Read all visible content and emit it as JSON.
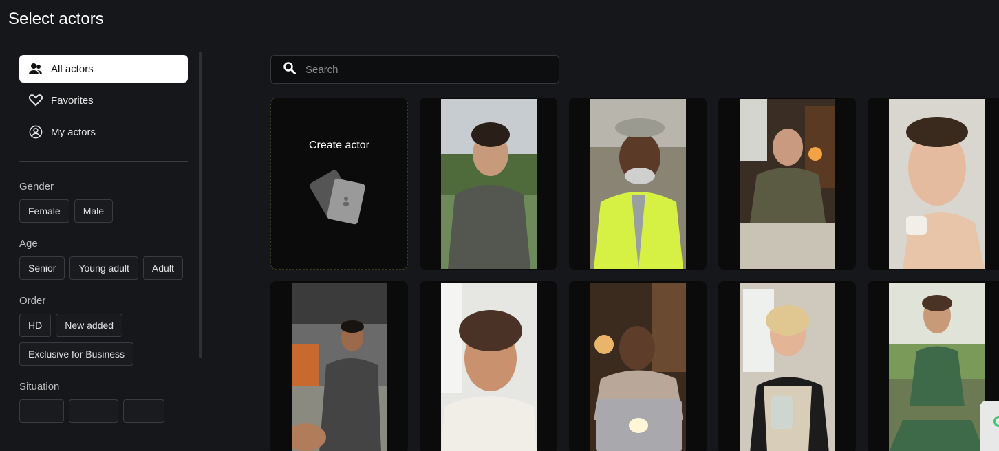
{
  "page": {
    "title": "Select actors"
  },
  "nav": {
    "items": [
      {
        "label": "All actors",
        "icon": "users-icon",
        "active": true
      },
      {
        "label": "Favorites",
        "icon": "heart-icon",
        "active": false
      },
      {
        "label": "My actors",
        "icon": "user-circle-icon",
        "active": false
      }
    ]
  },
  "filters": {
    "gender": {
      "label": "Gender",
      "options": [
        "Female",
        "Male"
      ]
    },
    "age": {
      "label": "Age",
      "options": [
        "Senior",
        "Young adult",
        "Adult"
      ]
    },
    "order": {
      "label": "Order",
      "options": [
        "HD",
        "New added",
        "Exclusive for Business"
      ]
    },
    "situation": {
      "label": "Situation"
    }
  },
  "search": {
    "placeholder": "Search",
    "value": ""
  },
  "create_card": {
    "label": "Create actor"
  },
  "actors": [
    {
      "name": "young-man-hiking"
    },
    {
      "name": "construction-worker"
    },
    {
      "name": "man-with-glasses-desk"
    },
    {
      "name": "woman-skincare"
    },
    {
      "name": "man-train-station"
    },
    {
      "name": "woman-bathrobe"
    },
    {
      "name": "man-laptop"
    },
    {
      "name": "older-woman-jar"
    },
    {
      "name": "woman-yoga"
    }
  ],
  "colors": {
    "background": "#16171b",
    "active_nav": "#ffffff",
    "whatsapp": "#3ac66b"
  }
}
